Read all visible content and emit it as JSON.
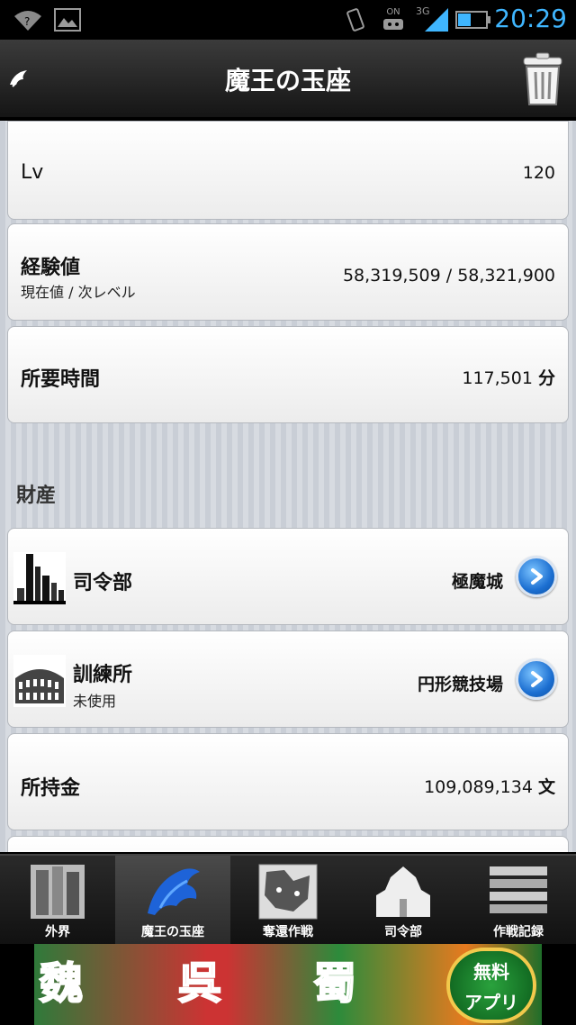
{
  "status_bar": {
    "time": "20:29",
    "icons": [
      "wifi-question-icon",
      "image-icon",
      "vibrate-icon",
      "usb-debug-icon",
      "signal-3g-icon",
      "battery-icon"
    ],
    "network_label": "3G",
    "debug_label": "ON"
  },
  "header": {
    "title": "魔王の玉座",
    "back_icon": "back-bird-icon",
    "trash_icon": "trash-icon"
  },
  "stats": {
    "lv": {
      "label": "Lv",
      "value": "120"
    },
    "exp": {
      "label": "経験値",
      "sub": "現在値 / 次レベル",
      "value": "58,319,509 / 58,321,900"
    },
    "time": {
      "label": "所要時間",
      "value": "117,501",
      "unit": "分"
    }
  },
  "assets": {
    "section_title": "財産",
    "hq": {
      "label": "司令部",
      "value": "極魔城"
    },
    "training": {
      "label": "訓練所",
      "sub": "未使用",
      "value": "円形競技場"
    },
    "money": {
      "label": "所持金",
      "value": "109,089,134",
      "unit": "文"
    }
  },
  "tabs": [
    {
      "label": "外界",
      "active": false
    },
    {
      "label": "魔王の玉座",
      "active": true
    },
    {
      "label": "奪還作戦",
      "active": false
    },
    {
      "label": "司令部",
      "active": false
    },
    {
      "label": "作戦記録",
      "active": false
    }
  ],
  "ad_banner": {
    "words": [
      "魏",
      "呉",
      "蜀"
    ],
    "badge_line1": "無料",
    "badge_line2": "アプリ"
  },
  "colors": {
    "accent_time": "#3fb6ff",
    "chevron_blue": "#1c6fd1",
    "titlebar": "#2a2a2a"
  }
}
